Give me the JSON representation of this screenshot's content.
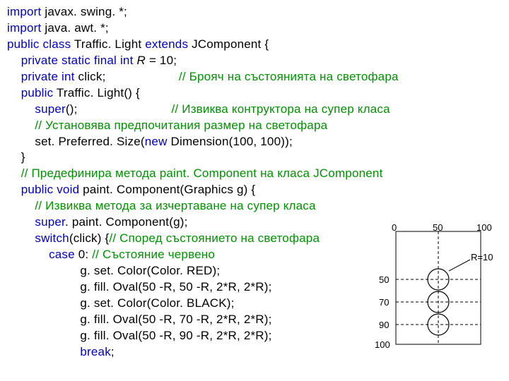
{
  "code": {
    "l1a": "import",
    "l1b": " javax. swing. *;",
    "l2a": "import",
    "l2b": " java. awt. *;",
    "l3a": "public class",
    "l3b": " Traffic. Light ",
    "l3c": "extends",
    "l3d": " JComponent {",
    "l4a": "    private static final int",
    "l4b": " ",
    "l4c": "R",
    "l4d": " = 10;",
    "l5a": "    private int",
    "l5b": " click;                     ",
    "l5c": "// Брояч на състоянията на светофара",
    "l6a": "    public",
    "l6b": " Traffic. Light() {",
    "l7a": "        super",
    "l7b": "();                           ",
    "l7c": "// Извиква контруктора на супер класа",
    "l8": "        // Установява предпочитания размер на светофара",
    "l9a": "        set. Preferred. Size(",
    "l9b": "new ",
    "l9c": "Dimension(100, 100));",
    "l10": "    }",
    "l11": "    // Предефинира метода paint. Component на класа JComponent",
    "l12a": "    public void",
    "l12b": " paint. Component(Graphics g) {",
    "l13": "        // Извиква метода за изчертаване на супер класа",
    "l14a": "        super",
    "l14b": ". paint. Component(g);",
    "l15a": "        switch",
    "l15b": "(click) {",
    "l15c": "// Според състоянието на светофара",
    "l16a": "            case",
    "l16b": " 0: ",
    "l16c": "// Състояние червено",
    "l17": "                     g. set. Color(Color. RED);",
    "l18": "                     g. fill. Oval(50 -R, 50 -R, 2*R, 2*R);",
    "l19": "                     g. set. Color(Color. BLACK);",
    "l20": "                     g. fill. Oval(50 -R, 70 -R, 2*R, 2*R);",
    "l21": "                     g. fill. Oval(50 -R, 90 -R, 2*R, 2*R);",
    "l22a": "                     break",
    "l22b": ";"
  },
  "diagram": {
    "x0": "0",
    "x50": "50",
    "x100": "100",
    "y50": "50",
    "y70": "70",
    "y90": "90",
    "y100": "100",
    "rlabel": "R=10"
  }
}
